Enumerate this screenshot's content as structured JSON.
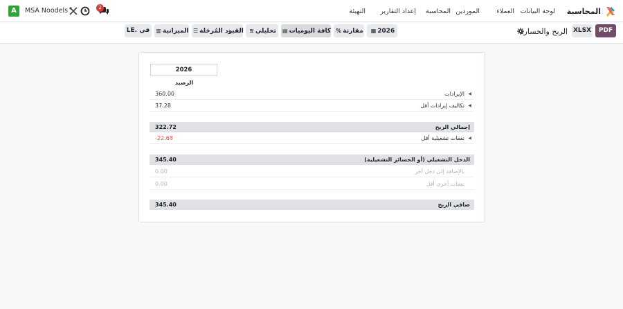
{
  "navbar": {
    "app_name": "المحاسبة",
    "menu": [
      "لوحة البيانات",
      "العملاء",
      "الموردين",
      "المحاسبة",
      "إعداد التقارير",
      "التهيئة"
    ],
    "company": "MSA Noodels",
    "avatar_letter": "A",
    "chat_badge": "2"
  },
  "control_panel": {
    "pdf_label": "PDF",
    "xlsx_label": "XLSX",
    "report_title": "الربح والخسارة",
    "filters": {
      "period": "2026",
      "comparison": "مقارنة",
      "journals": "كافة اليوميات",
      "analytic": "تحليلي",
      "posted_entries": "القيود المُرحَلة",
      "budget": "الميزانية",
      "currency": "في .LE"
    }
  },
  "report": {
    "period_header": "2026",
    "column_header": "الرصيد",
    "lines": [
      {
        "label": "الإيرادات",
        "amount": "360.00",
        "kind": "line"
      },
      {
        "label": "تكاليف إيرادات أقل",
        "amount": "37.28",
        "kind": "line"
      },
      {
        "label": "إجمالي الربح",
        "amount": "322.72",
        "kind": "total"
      },
      {
        "label": "نفقات تشغيلية أقل",
        "amount": "-22.68",
        "kind": "line"
      },
      {
        "label": "الدخل التشغيلي (أو الخسائر التشغيلية)",
        "amount": "345.40",
        "kind": "total"
      },
      {
        "label": "بالإضافة إلى دخل آخر",
        "amount": "0.00",
        "kind": "zero"
      },
      {
        "label": "نفقات أخرى أقل",
        "amount": "0.00",
        "kind": "zero"
      },
      {
        "label": "صافي الربح",
        "amount": "345.40",
        "kind": "total"
      }
    ]
  },
  "colors": {
    "brand": "#714b67",
    "negative": "#d9534f",
    "avatar": "#2ea33a"
  }
}
